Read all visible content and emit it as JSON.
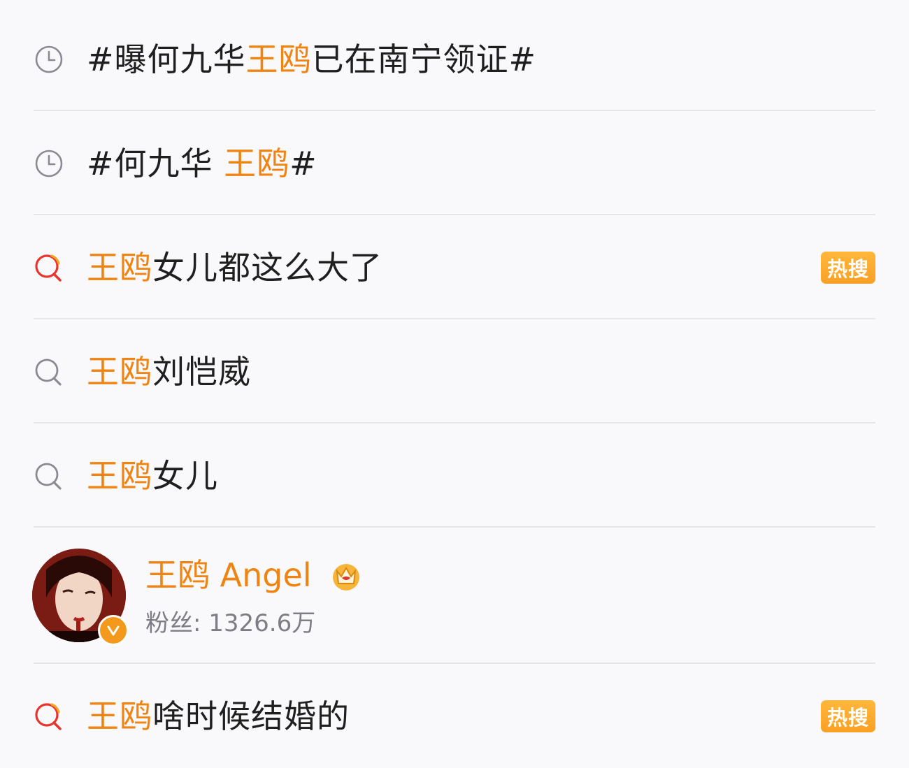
{
  "highlight_color": "#f08412",
  "items": [
    {
      "type": "history",
      "icon": "clock-icon",
      "prefix": "#曝何九华",
      "keyword": "王鸥",
      "suffix": "已在南宁领证#"
    },
    {
      "type": "history",
      "icon": "clock-icon",
      "prefix": "#何九华 ",
      "keyword": "王鸥",
      "suffix": "#"
    },
    {
      "type": "hot-suggestion",
      "icon": "hot-search-icon",
      "prefix": "",
      "keyword": "王鸥",
      "suffix": "女儿都这么大了",
      "badge": "热搜"
    },
    {
      "type": "suggestion",
      "icon": "search-icon",
      "prefix": "",
      "keyword": "王鸥",
      "suffix": "刘恺威"
    },
    {
      "type": "suggestion",
      "icon": "search-icon",
      "prefix": "",
      "keyword": "王鸥",
      "suffix": "女儿"
    }
  ],
  "user": {
    "name": "王鸥 Angel",
    "followers_label": "粉丝: 1326.6万",
    "badge_icon": "crown-icon",
    "verified_icon": "verified-v-icon"
  },
  "last_item": {
    "type": "hot-suggestion",
    "icon": "hot-search-icon",
    "prefix": "",
    "keyword": "王鸥",
    "suffix": "啥时候结婚的",
    "badge": "热搜"
  }
}
